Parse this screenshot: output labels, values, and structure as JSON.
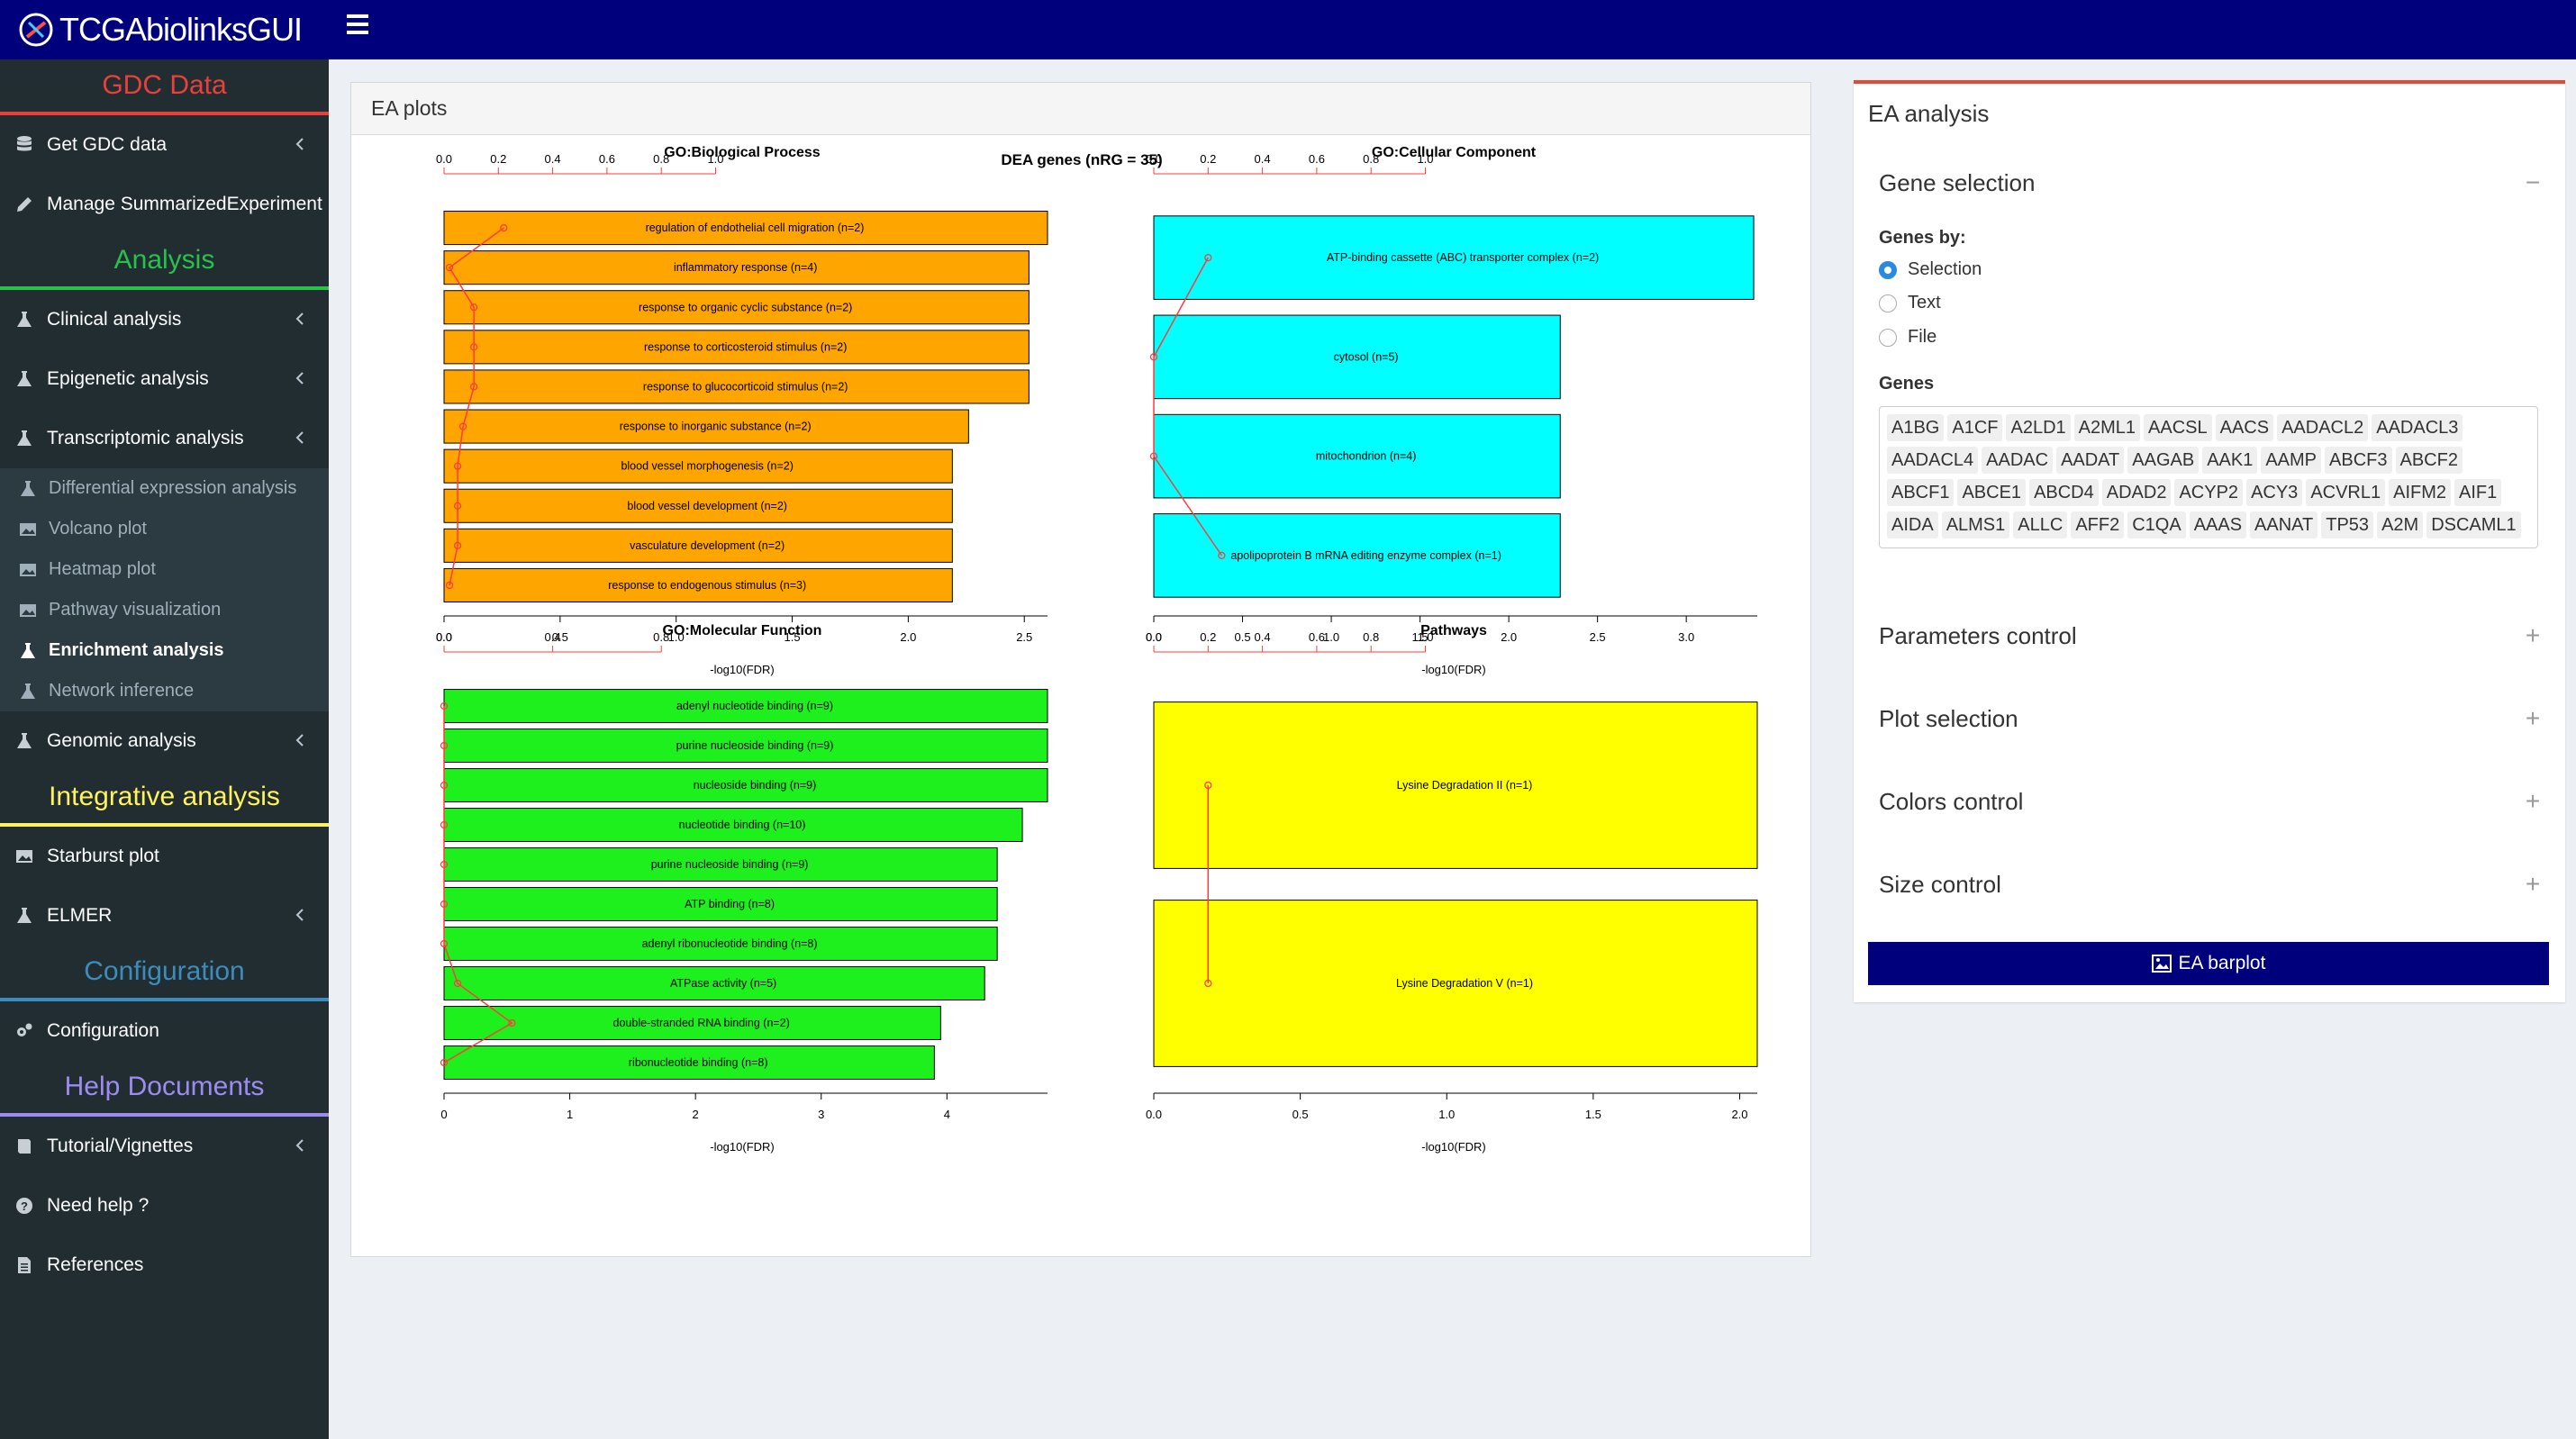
{
  "app": {
    "title": "TCGAbiolinksGUI"
  },
  "sidebar": {
    "gdc_header": "GDC Data",
    "get_gdc": "Get GDC data",
    "manage": "Manage SummarizedExperiment",
    "analysis_header": "Analysis",
    "clinical": "Clinical analysis",
    "epigenetic": "Epigenetic analysis",
    "transcriptomic": "Transcriptomic analysis",
    "sub": {
      "dea": "Differential expression analysis",
      "volcano": "Volcano plot",
      "heatmap": "Heatmap plot",
      "pathway": "Pathway visualization",
      "enrichment": "Enrichment analysis",
      "network": "Network inference"
    },
    "genomic": "Genomic analysis",
    "integrative_header": "Integrative analysis",
    "starburst": "Starburst plot",
    "elmer": "ELMER",
    "config_header": "Configuration",
    "configuration": "Configuration",
    "help_header": "Help Documents",
    "tutorial": "Tutorial/Vignettes",
    "needhelp": "Need help ?",
    "references": "References"
  },
  "colors": {
    "gdc": "#e8403a",
    "analysis": "#27c24c",
    "integrative": "#fff35c",
    "config": "#3c8dbc",
    "help": "#9d8cf0",
    "bp_bar": "#ffa500",
    "cc_bar": "#00ffff",
    "mf_bar": "#1ef01e",
    "pw_bar": "#ffff00",
    "line": "#ff3c3c"
  },
  "plots_box": {
    "title": "EA plots"
  },
  "ea_panel": {
    "title": "EA analysis",
    "gene_selection": "Gene selection",
    "genes_by": "Genes by:",
    "opt_selection": "Selection",
    "opt_text": "Text",
    "opt_file": "File",
    "genes_label": "Genes",
    "genes": [
      "A1BG",
      "A1CF",
      "A2LD1",
      "A2ML1",
      "AACSL",
      "AACS",
      "AADACL2",
      "AADACL3",
      "AADACL4",
      "AADAC",
      "AADAT",
      "AAGAB",
      "AAK1",
      "AAMP",
      "ABCF3",
      "ABCF2",
      "ABCF1",
      "ABCE1",
      "ABCD4",
      "ADAD2",
      "ACYP2",
      "ACY3",
      "ACVRL1",
      "AIFM2",
      "AIF1",
      "AIDA",
      "ALMS1",
      "ALLC",
      "AFF2",
      "C1QA",
      "AAAS",
      "AANAT",
      "TP53",
      "A2M",
      "DSCAML1"
    ],
    "params": "Parameters control",
    "plot_sel": "Plot selection",
    "colors": "Colors control",
    "size": "Size control",
    "button": "EA barplot"
  },
  "chart_data": {
    "title": "DEA genes (nRG = 35)",
    "panels": [
      {
        "type": "bar",
        "title": "GO:Biological Process",
        "xlabel": "-log10(FDR)",
        "xlim": [
          0,
          2.6
        ],
        "xticks": [
          "0.0",
          "0.5",
          "1.0",
          "1.5",
          "2.0",
          "2.5"
        ],
        "top_ticks": [
          "0.0",
          "0.2",
          "0.4",
          "0.6",
          "0.8",
          "1.0"
        ],
        "categories": [
          "regulation of endothelial cell migration (n=2)",
          "inflammatory response (n=4)",
          "response to organic cyclic substance (n=2)",
          "response to corticosteroid stimulus (n=2)",
          "response to glucocorticoid stimulus (n=2)",
          "response to inorganic substance (n=2)",
          "blood vessel morphogenesis (n=2)",
          "blood vessel development (n=2)",
          "vasculature development (n=2)",
          "response to endogenous stimulus (n=3)"
        ],
        "values": [
          2.6,
          2.52,
          2.52,
          2.52,
          2.52,
          2.26,
          2.19,
          2.19,
          2.19,
          2.19
        ],
        "ratio": [
          0.22,
          0.02,
          0.11,
          0.11,
          0.11,
          0.07,
          0.05,
          0.05,
          0.05,
          0.02
        ]
      },
      {
        "type": "bar",
        "title": "GO:Cellular Component",
        "xlabel": "-log10(FDR)",
        "xlim": [
          0,
          3.4
        ],
        "xticks": [
          "0.0",
          "0.5",
          "1.0",
          "1.5",
          "2.0",
          "2.5",
          "3.0"
        ],
        "top_ticks": [
          "0.0",
          "0.2",
          "0.4",
          "0.6",
          "0.8",
          "1.0"
        ],
        "categories": [
          "ATP-binding cassette (ABC) transporter complex (n=2)",
          "cytosol (n=5)",
          "mitochondrion (n=4)",
          "apolipoprotein B mRNA editing enzyme complex (n=1)"
        ],
        "values": [
          3.38,
          2.29,
          2.29,
          2.29
        ],
        "ratio": [
          0.2,
          0.0,
          0.0,
          0.25
        ]
      },
      {
        "type": "bar",
        "title": "GO:Molecular Function",
        "xlabel": "-log10(FDR)",
        "xlim": [
          0,
          4.8
        ],
        "xticks": [
          "0",
          "1",
          "2",
          "3",
          "4"
        ],
        "top_ticks": [
          "0.0",
          "0.4",
          "0.8"
        ],
        "categories": [
          "adenyl nucleotide binding (n=9)",
          "purine nucleoside binding (n=9)",
          "nucleoside binding (n=9)",
          "nucleotide binding (n=10)",
          "purine nucleoside binding (n=9)",
          "ATP binding (n=8)",
          "adenyl ribonucleotide binding (n=8)",
          "ATPase activity (n=5)",
          "double-stranded RNA binding (n=2)",
          "ribonucleotide binding (n=8)"
        ],
        "values": [
          4.8,
          4.8,
          4.8,
          4.6,
          4.4,
          4.4,
          4.4,
          4.3,
          3.95,
          3.9
        ],
        "ratio": [
          0.0,
          0.0,
          0.0,
          0.0,
          0.0,
          0.0,
          0.0,
          0.05,
          0.25,
          0.0
        ]
      },
      {
        "type": "bar",
        "title": "Pathways",
        "xlabel": "-log10(FDR)",
        "xlim": [
          0,
          2.06
        ],
        "xticks": [
          "0.0",
          "0.5",
          "1.0",
          "1.5",
          "2.0"
        ],
        "top_ticks": [
          "0.0",
          "0.2",
          "0.4",
          "0.6",
          "0.8",
          "1.0"
        ],
        "categories": [
          "Lysine Degradation II (n=1)",
          "Lysine Degradation V (n=1)"
        ],
        "values": [
          2.06,
          2.06
        ],
        "ratio": [
          0.2,
          0.2
        ]
      }
    ]
  }
}
